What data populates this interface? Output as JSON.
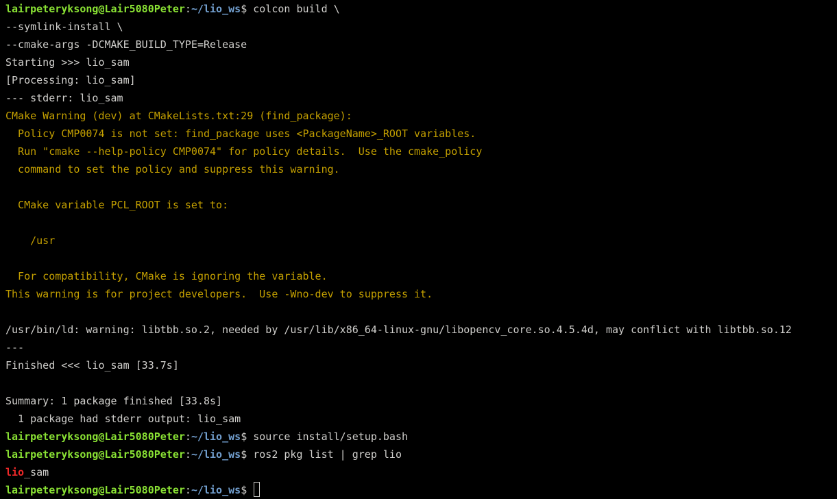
{
  "colors": {
    "background": "#000000",
    "foreground": "#d0cfcc",
    "prompt_user": "#8ae234",
    "prompt_path": "#729fcf",
    "warning": "#c4a000",
    "grep_match": "#ef2929"
  },
  "prompt": {
    "user_host": "lairpeteryksong@Lair5080Peter",
    "colon": ":",
    "path": "~/lio_ws",
    "dollar": "$ "
  },
  "commands": {
    "build": "colcon build \\",
    "source": "source install/setup.bash",
    "list": "ros2 pkg list | grep lio"
  },
  "output": {
    "build_args_1": "--symlink-install \\",
    "build_args_2": "--cmake-args -DCMAKE_BUILD_TYPE=Release",
    "starting": "Starting >>> lio_sam",
    "processing": "[Processing: lio_sam]",
    "stderr_header": "--- stderr: lio_sam",
    "warn_1": "CMake Warning (dev) at CMakeLists.txt:29 (find_package):",
    "warn_2": "  Policy CMP0074 is not set: find_package uses <PackageName>_ROOT variables.",
    "warn_3": "  Run \"cmake --help-policy CMP0074\" for policy details.  Use the cmake_policy",
    "warn_4": "  command to set the policy and suppress this warning.",
    "warn_5": "  CMake variable PCL_ROOT is set to:",
    "warn_6": "    /usr",
    "warn_7": "  For compatibility, CMake is ignoring the variable.",
    "warn_8": "This warning is for project developers.  Use -Wno-dev to suppress it.",
    "ld_warning": "/usr/bin/ld: warning: libtbb.so.2, needed by /usr/lib/x86_64-linux-gnu/libopencv_core.so.4.5.4d, may conflict with libtbb.so.12",
    "separator": "---",
    "finished": "Finished <<< lio_sam [33.7s]",
    "summary": "Summary: 1 package finished [33.8s]",
    "summary_detail": "  1 package had stderr output: lio_sam",
    "grep_match": "lio",
    "grep_rest": "_sam"
  }
}
